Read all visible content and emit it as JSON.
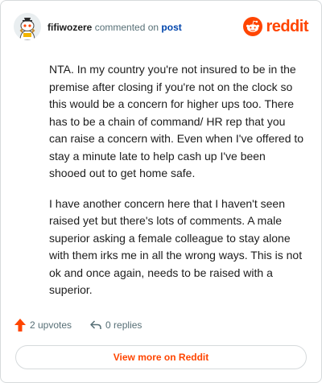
{
  "comment": {
    "username": "fifiwozere",
    "action_text": "commented on",
    "target_link": "post",
    "paragraphs": [
      "NTA. In my country you're not insured to be in the premise after closing if you're not on the clock so this would be a concern for higher ups too. There has to be a chain of command/ HR rep that you can raise a concern with. Even when I've offered to stay a minute late to help cash up I've been shooed out to get home safe.",
      "I have another concern here that I haven't seen raised yet but there's lots of comments. A male superior asking a female colleague to stay alone with them irks me in all the wrong ways. This is not ok and once again, needs to be raised with a superior."
    ]
  },
  "brand": {
    "wordmark": "reddit",
    "accent_color": "#ff4500"
  },
  "actions": {
    "upvotes_label": "2 upvotes",
    "replies_label": "0 replies"
  },
  "footer": {
    "view_more_label": "View more on Reddit"
  },
  "icons": {
    "avatar": "snoo-avatar-icon",
    "logo": "reddit-logo-icon",
    "upvote": "upvote-arrow-icon",
    "reply": "reply-arrow-icon"
  }
}
